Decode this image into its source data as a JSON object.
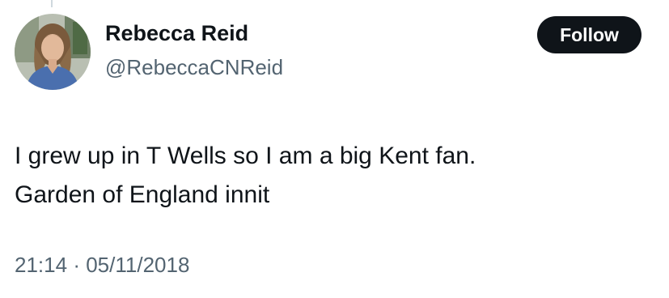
{
  "author": {
    "display_name": "Rebecca Reid",
    "handle": "@RebeccaCNReid"
  },
  "follow_button": {
    "label": "Follow"
  },
  "tweet": {
    "lines": [
      "I grew up in T Wells so I am a big Kent fan.",
      "Garden of England innit"
    ],
    "time": "21:14",
    "separator": "·",
    "date": "05/11/2018"
  },
  "colors": {
    "text_primary": "#0f1419",
    "text_secondary": "#536471",
    "button_bg": "#0f1419",
    "button_text": "#ffffff"
  }
}
